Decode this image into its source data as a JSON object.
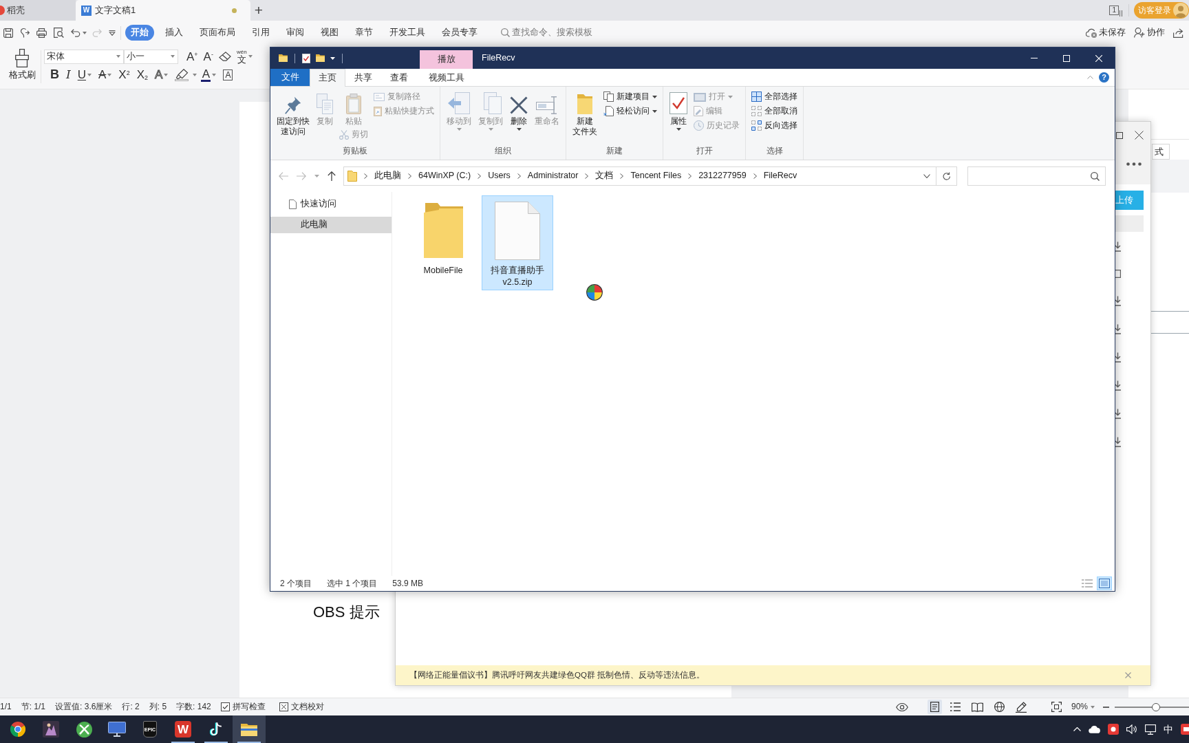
{
  "wps_tabs": {
    "tabs": [
      {
        "kind": "docer",
        "label": "稻壳",
        "selected": false
      },
      {
        "kind": "writer",
        "logo": "W",
        "label": "文字文稿1",
        "selected": true,
        "modified": true
      }
    ],
    "new_tab": "+",
    "window_count": "1",
    "login_button": "访客登录"
  },
  "wps_menu": {
    "quick_tools": [
      {
        "kind": "save",
        "disabled": false
      },
      {
        "kind": "export",
        "disabled": false
      },
      {
        "kind": "print",
        "disabled": false
      },
      {
        "kind": "preview",
        "disabled": false
      },
      {
        "kind": "undo",
        "disabled": false,
        "caret": true
      },
      {
        "kind": "redo",
        "disabled": true
      },
      {
        "kind": "customize",
        "disabled": false
      }
    ],
    "tabs": [
      {
        "label": "开始",
        "selected": true
      },
      {
        "label": "插入",
        "selected": false
      },
      {
        "label": "页面布局",
        "selected": false
      },
      {
        "label": "引用",
        "selected": false
      },
      {
        "label": "审阅",
        "selected": false
      },
      {
        "label": "视图",
        "selected": false
      },
      {
        "label": "章节",
        "selected": false
      },
      {
        "label": "开发工具",
        "selected": false
      },
      {
        "label": "会员专享",
        "selected": false
      }
    ],
    "search": {
      "placeholder": "查找命令、搜索模板"
    },
    "actions": [
      {
        "kind": "cloud",
        "label": "未保存"
      },
      {
        "kind": "collab",
        "label": "协作"
      },
      {
        "kind": "share"
      }
    ]
  },
  "wps_ribbon": {
    "format_painter": "格式刷",
    "font_name": "宋体",
    "font_size": "小一",
    "font_tools": [
      {
        "kind": "grow",
        "glyph": "A$^{+}$"
      },
      {
        "kind": "shrink",
        "glyph": "A$^{-}$"
      },
      {
        "kind": "eraser"
      },
      {
        "kind": "phonetic",
        "ruby": "wén",
        "glyph": "文",
        "caret": true
      }
    ],
    "format_tools": [
      {
        "kind": "bold",
        "glyph": "B"
      },
      {
        "kind": "italic",
        "glyph": "I"
      },
      {
        "kind": "underline",
        "glyph": "U",
        "caret": true
      },
      {
        "kind": "strike",
        "glyph": "A",
        "caret": true
      },
      {
        "kind": "superscript",
        "glyph": "X$^{2}$"
      },
      {
        "kind": "subscript",
        "glyph": "X$_{2}$"
      },
      {
        "kind": "outline",
        "glyph": "A",
        "caret": true
      },
      {
        "kind": "highlight",
        "caret": true
      },
      {
        "kind": "font_color",
        "glyph": "A",
        "caret": true,
        "color": "#1a1f6e"
      },
      {
        "kind": "boxed",
        "glyph": "A"
      }
    ]
  },
  "document": {
    "lines": [
      "OBS 提示"
    ]
  },
  "task_pane": {
    "field": "式"
  },
  "status_bar": {
    "fields": [
      "1/1",
      "节: 1/1",
      "设置值: 3.6厘米",
      "行: 2",
      "列: 5",
      "字数: 142"
    ],
    "checks": [
      {
        "kind": "spell",
        "label": "拼写检查"
      },
      {
        "kind": "proof",
        "label": "文档校对"
      }
    ],
    "view_modes": [
      {
        "kind": "page",
        "selected": true
      },
      {
        "kind": "outline",
        "selected": false
      },
      {
        "kind": "reading",
        "selected": false
      },
      {
        "kind": "web",
        "selected": false
      },
      {
        "kind": "write",
        "selected": false
      }
    ],
    "zoom": "90%",
    "zoom_slider": {
      "level": 0.56
    }
  },
  "qq_window": {
    "upload_button": "上传",
    "banner": "【网络正能量倡议书】腾讯呼吁网友共建绿色QQ群 抵制色情、反动等违法信息。"
  },
  "explorer": {
    "title": "FileRecv",
    "context_header": "播放",
    "tabs": [
      {
        "kind": "file",
        "label": "文件",
        "selected": false
      },
      {
        "kind": "tab",
        "label": "主页",
        "selected": true
      },
      {
        "kind": "tab",
        "label": "共享",
        "selected": false
      },
      {
        "kind": "tab",
        "label": "查看",
        "selected": false
      },
      {
        "kind": "contextual",
        "label": "视频工具",
        "selected": false
      }
    ],
    "help": "?",
    "ribbon_groups": [
      {
        "label": "剪贴板",
        "columns": [
          [
            {
              "kind": "pin",
              "lines": [
                "固定到快",
                "速访问"
              ],
              "disabled": false
            }
          ],
          [
            {
              "kind": "copy",
              "label": "复制",
              "disabled": true
            }
          ],
          [
            {
              "kind": "paste",
              "label": "粘贴",
              "disabled": true
            },
            {
              "kind": "cut",
              "label": "剪切",
              "disabled": true
            }
          ],
          [
            {
              "kind": "copy_path",
              "label": "复制路径",
              "disabled": true
            },
            {
              "kind": "paste_shortcut",
              "label": "粘贴快捷方式",
              "disabled": true
            }
          ]
        ]
      },
      {
        "label": "组织",
        "columns": [
          [
            {
              "kind": "move",
              "label": "移动到",
              "disabled": true,
              "caret": true
            }
          ],
          [
            {
              "kind": "copy_to",
              "label": "复制到",
              "disabled": true,
              "caret": true
            }
          ],
          [
            {
              "kind": "delete",
              "label": "删除",
              "disabled": false,
              "caret": true
            }
          ],
          [
            {
              "kind": "rename",
              "label": "重命名",
              "disabled": true
            }
          ]
        ]
      },
      {
        "label": "新建",
        "columns": [
          [
            {
              "kind": "new_folder",
              "lines": [
                "新建",
                "文件夹"
              ],
              "disabled": false
            }
          ],
          [
            {
              "kind": "new_item",
              "label": "新建项目",
              "disabled": false,
              "caret": true
            },
            {
              "kind": "easy_access",
              "label": "轻松访问",
              "disabled": false,
              "caret": true
            }
          ]
        ]
      },
      {
        "label": "打开",
        "columns": [
          [
            {
              "kind": "properties",
              "label": "属性",
              "disabled": false,
              "caret": true
            }
          ],
          [
            {
              "kind": "open",
              "label": "打开",
              "disabled": true,
              "caret": true
            },
            {
              "kind": "edit",
              "label": "编辑",
              "disabled": true
            },
            {
              "kind": "history",
              "label": "历史记录",
              "disabled": true
            }
          ]
        ]
      },
      {
        "label": "选择",
        "columns": [
          [
            {
              "kind": "select_all",
              "label": "全部选择",
              "disabled": false
            },
            {
              "kind": "select_none",
              "label": "全部取消",
              "disabled": false
            },
            {
              "kind": "invert",
              "label": "反向选择",
              "disabled": false
            }
          ]
        ]
      }
    ],
    "address": [
      "此电脑",
      "64WinXP (C:)",
      "Users",
      "Administrator",
      "文档",
      "Tencent Files",
      "2312277959",
      "FileRecv"
    ],
    "nav": [
      {
        "kind": "quick_access",
        "label": "快速访问",
        "selected": false
      },
      {
        "kind": "this_pc",
        "label": "此电脑",
        "selected": true
      }
    ],
    "files": [
      {
        "kind": "folder",
        "name": "MobileFile",
        "selected": false
      },
      {
        "kind": "file",
        "name": "抖音直播助手v2.5.zip",
        "selected": true
      }
    ],
    "status": {
      "count": "2 个项目",
      "selection": "选中 1 个项目",
      "size": "53.9 MB"
    },
    "view_buttons": [
      {
        "kind": "details",
        "selected": false
      },
      {
        "kind": "large_icons",
        "selected": true
      }
    ]
  },
  "taskbar": {
    "apps": [
      {
        "kind": "chrome",
        "running": false,
        "selected": false
      },
      {
        "kind": "game",
        "running": false,
        "selected": false
      },
      {
        "kind": "sphere",
        "running": false,
        "selected": false
      },
      {
        "kind": "monitor",
        "running": false,
        "selected": false
      },
      {
        "kind": "epic",
        "label": "EPIC",
        "running": false,
        "selected": false
      },
      {
        "kind": "writer",
        "label": "W",
        "running": true,
        "selected": false
      },
      {
        "kind": "tiktok",
        "running": true,
        "selected": false
      },
      {
        "kind": "explorer",
        "running": true,
        "selected": true
      }
    ],
    "ime": "中"
  }
}
